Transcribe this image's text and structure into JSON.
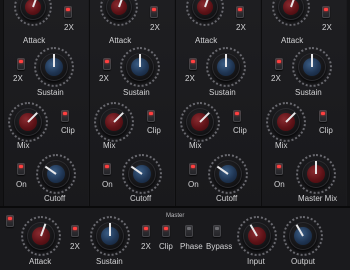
{
  "bands": [
    {
      "attack_label": "Attack",
      "twox_label": "2X",
      "sustain_label": "Sustain",
      "mix_label": "Mix",
      "clip_label": "Clip",
      "on_label": "On",
      "cutoff_label": "Cutoff"
    },
    {
      "attack_label": "Attack",
      "twox_label": "2X",
      "sustain_label": "Sustain",
      "mix_label": "Mix",
      "clip_label": "Clip",
      "on_label": "On",
      "cutoff_label": "Cutoff"
    },
    {
      "attack_label": "Attack",
      "twox_label": "2X",
      "sustain_label": "Sustain",
      "mix_label": "Mix",
      "clip_label": "Clip",
      "on_label": "On",
      "cutoff_label": "Cutoff"
    },
    {
      "attack_label": "Attack",
      "twox_label": "2X",
      "sustain_label": "Sustain",
      "mix_label": "Mix",
      "clip_label": "Clip",
      "on_label": "On",
      "master_mix_label": "Master Mix"
    }
  ],
  "master": {
    "title": "Master",
    "attack_label": "Attack",
    "twox_a_label": "2X",
    "sustain_label": "Sustain",
    "twox_b_label": "2X",
    "clip_label": "Clip",
    "phase_label": "Phase",
    "bypass_label": "Bypass",
    "input_label": "Input",
    "output_label": "Output"
  },
  "colors": {
    "background": "#141416",
    "knob_red": "#5e1217",
    "knob_blue": "#1f3553",
    "led_on": "#ff4040"
  }
}
